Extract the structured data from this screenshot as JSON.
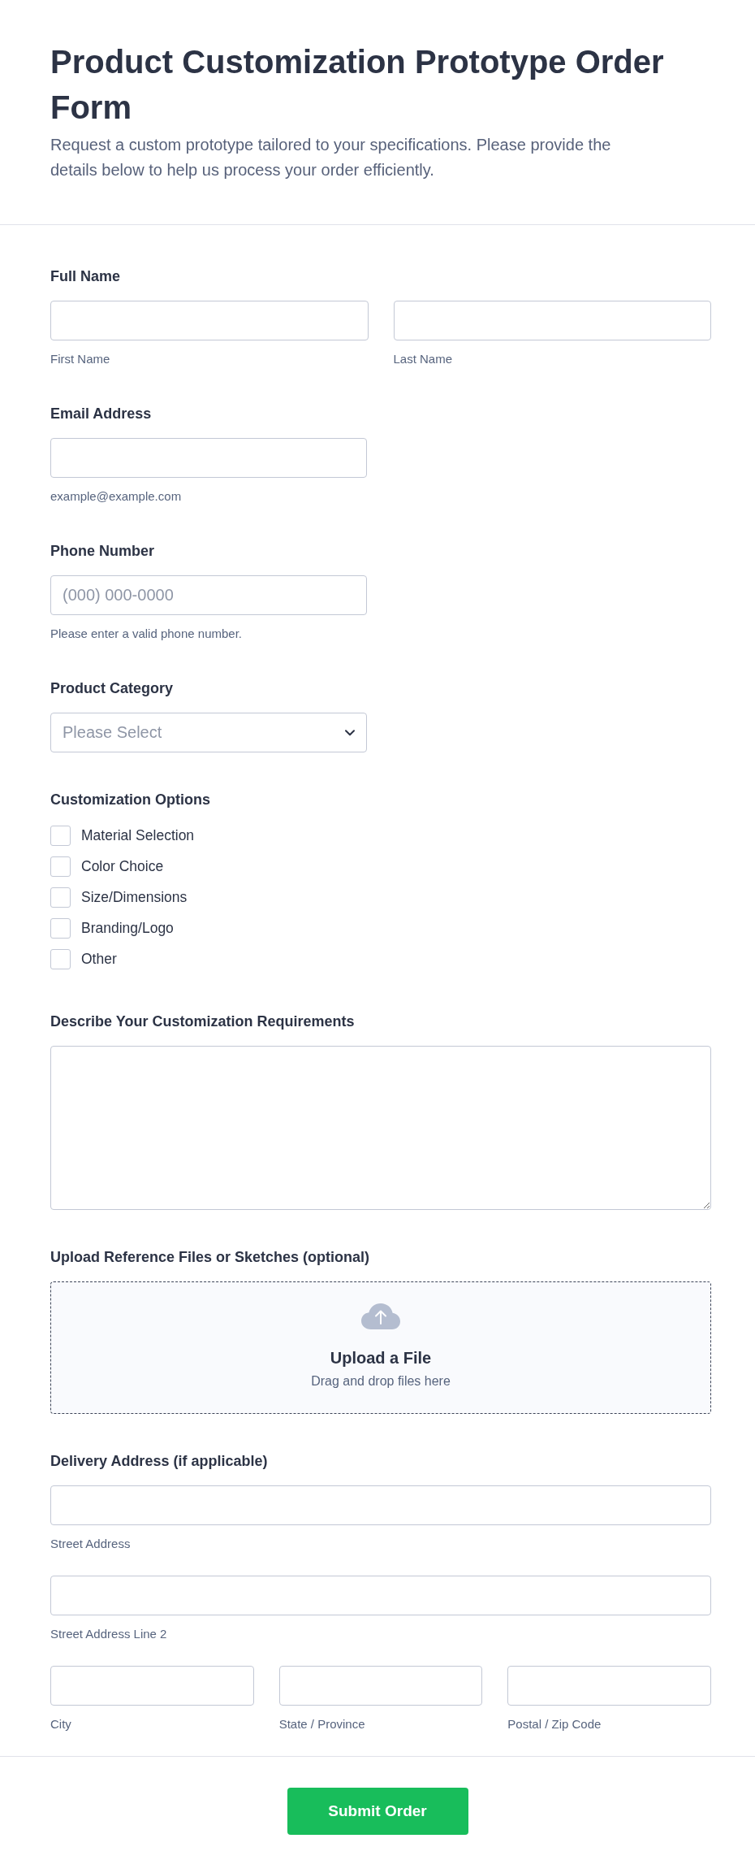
{
  "header": {
    "title": "Product Customization Prototype Order Form",
    "description": "Request a custom prototype tailored to your specifications. Please provide the details below to help us process your order efficiently."
  },
  "fields": [
    {
      "kind": "group",
      "label": "Full Name",
      "rows": [
        [
          {
            "sublabel": "First Name"
          },
          {
            "sublabel": "Last Name"
          }
        ]
      ]
    },
    {
      "kind": "email",
      "label": "Email Address",
      "sublabel": "example@example.com"
    },
    {
      "kind": "phone",
      "label": "Phone Number",
      "placeholder": "(000) 000-0000",
      "sublabel": "Please enter a valid phone number."
    },
    {
      "kind": "dropdown",
      "label": "Product Category",
      "placeholder": "Please Select"
    },
    {
      "kind": "checkboxes",
      "label": "Customization Options",
      "options": [
        {
          "label": "Material Selection",
          "checked": false
        },
        {
          "label": "Color Choice",
          "checked": false
        },
        {
          "label": "Size/Dimensions",
          "checked": false
        },
        {
          "label": "Branding/Logo",
          "checked": false
        },
        {
          "label": "Other",
          "checked": false
        }
      ]
    },
    {
      "kind": "textarea",
      "label": "Describe Your Customization Requirements"
    },
    {
      "kind": "upload",
      "label": "Upload Reference Files or Sketches (optional)",
      "title": "Upload a File",
      "hint": "Drag and drop files here"
    },
    {
      "kind": "group",
      "label": "Delivery Address (if applicable)",
      "rows": [
        [
          {
            "sublabel": "Street Address"
          }
        ],
        [
          {
            "sublabel": "Street Address Line 2"
          }
        ],
        [
          {
            "sublabel": "City"
          },
          {
            "sublabel": "State / Province"
          },
          {
            "sublabel": "Postal / Zip Code"
          }
        ]
      ]
    }
  ],
  "submit": {
    "label": "Submit Order"
  }
}
